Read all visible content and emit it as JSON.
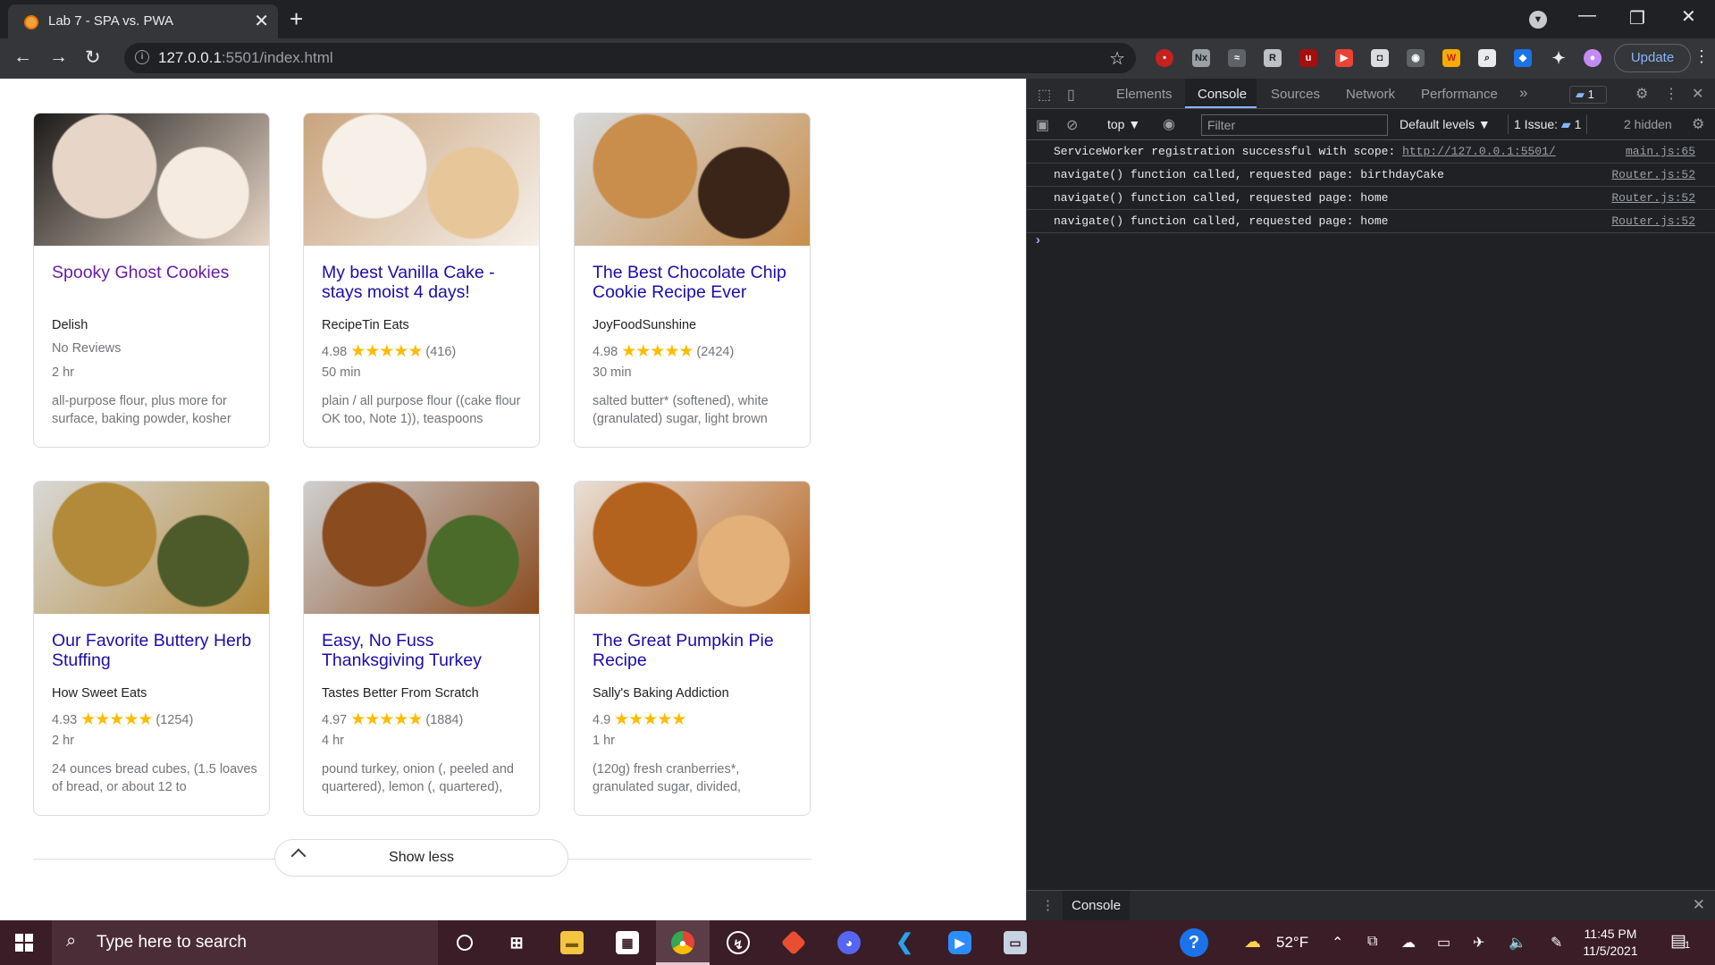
{
  "browser": {
    "tab_title": "Lab 7 - SPA vs. PWA",
    "tab_close_glyph": "✕",
    "new_tab_glyph": "+",
    "url_host": "127.0.0.1",
    "url_path": ":5501/index.html",
    "update_label": "Update",
    "icons": [
      "back-icon",
      "forward-icon",
      "reload-icon",
      "info-icon",
      "bookmark-star-icon",
      "extensions-icon",
      "menu-icon"
    ]
  },
  "recipes": [
    {
      "name": "Spooky Ghost Cookies",
      "visited": true,
      "source": "Delish",
      "rating_text": "No Reviews",
      "rating": "",
      "stars": "",
      "count": "",
      "time": "2 hr",
      "ingredients": "all-purpose flour, plus more for surface, baking powder, kosher",
      "image_colors": [
        "#1c1a19",
        "#e7d6c7",
        "#f5ebe0"
      ]
    },
    {
      "name": "My best Vanilla Cake - stays moist 4 days!",
      "visited": false,
      "source": "RecipeTin Eats",
      "rating_text": "",
      "rating": "4.98",
      "stars": "★★★★★",
      "count": "(416)",
      "time": "50 min",
      "ingredients": "plain / all purpose flour ((cake flour OK too, Note 1)), teaspoons",
      "image_colors": [
        "#c9a47f",
        "#f6f0e9",
        "#e7c79a"
      ]
    },
    {
      "name": "The Best Chocolate Chip Cookie Recipe Ever",
      "visited": false,
      "source": "JoyFoodSunshine",
      "rating_text": "",
      "rating": "4.98",
      "stars": "★★★★★",
      "count": "(2424)",
      "time": "30 min",
      "ingredients": "salted butter* (softened), white (granulated) sugar, light brown",
      "image_colors": [
        "#d8dadb",
        "#c98e4b",
        "#3a2518"
      ]
    },
    {
      "name": "Our Favorite Buttery Herb Stuffing",
      "visited": false,
      "source": "How Sweet Eats",
      "rating_text": "",
      "rating": "4.93",
      "stars": "★★★★★",
      "count": "(1254)",
      "time": "2 hr",
      "ingredients": "24 ounces bread cubes, (1.5 loaves of bread, or about 12 to",
      "image_colors": [
        "#d8d8d6",
        "#b38a3a",
        "#4d5a2a"
      ]
    },
    {
      "name": "Easy, No Fuss Thanksgiving Turkey",
      "visited": false,
      "source": "Tastes Better From Scratch",
      "rating_text": "",
      "rating": "4.97",
      "stars": "★★★★★",
      "count": "(1884)",
      "time": "4 hr",
      "ingredients": "pound turkey, onion (, peeled and quartered), lemon (, quartered),",
      "image_colors": [
        "#cfcfcf",
        "#8a4b1f",
        "#4a6b2a"
      ]
    },
    {
      "name": "The Great Pumpkin Pie Recipe",
      "visited": false,
      "source": "Sally's Baking Addiction",
      "rating_text": "",
      "rating": "4.9",
      "stars": "★★★★★",
      "count": "",
      "time": "1 hr",
      "ingredients": "(120g) fresh cranberries*, granulated sugar, divided,",
      "image_colors": [
        "#e9dfd6",
        "#b4631e",
        "#e3b07a"
      ]
    }
  ],
  "show_less_label": "Show less",
  "devtools": {
    "tabs": [
      "Elements",
      "Console",
      "Sources",
      "Network",
      "Performance"
    ],
    "active_tab": "Console",
    "more_tabs_glyph": "»",
    "message_badge": "1",
    "context": "top ▼",
    "filter_placeholder": "Filter",
    "levels": "Default levels ▼",
    "issues_label": "1 Issue:",
    "issues_count": "1",
    "hidden": "2 hidden",
    "logs": [
      {
        "prefix": "ServiceWorker registration successful with scope: ",
        "link": "http://127.0.0.1:5501/",
        "source": "main.js:65"
      },
      {
        "prefix": "navigate() function called, requested page: birthdayCake",
        "link": "",
        "source": "Router.js:52"
      },
      {
        "prefix": "navigate() function called, requested page: home",
        "link": "",
        "source": "Router.js:52"
      },
      {
        "prefix": "navigate() function called, requested page: home",
        "link": "",
        "source": "Router.js:52"
      }
    ],
    "prompt": "›",
    "drawer_tab": "Console"
  },
  "taskbar": {
    "search_placeholder": "Type here to search",
    "weather": "52°F",
    "time": "11:45 PM",
    "date": "11/5/2021",
    "notifications": "1"
  }
}
